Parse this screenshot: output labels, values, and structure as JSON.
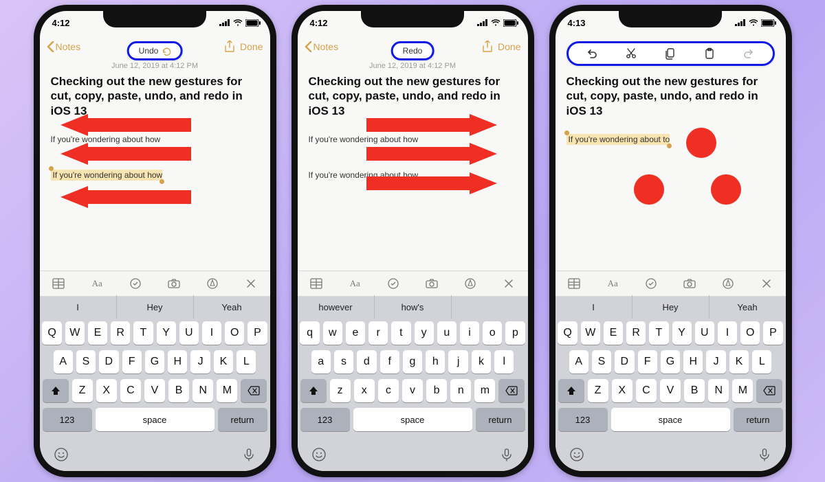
{
  "phones": [
    {
      "time": "4:12",
      "toast": "Undo",
      "back": "Notes",
      "done": "Done",
      "date": "June 12, 2019 at 4:12 PM",
      "title": "Checking out the new gestures for cut, copy, paste, undo, and redo in  iOS 13",
      "line1": "If you're wondering about how",
      "selected": "If you're wondering about how",
      "predict": [
        "I",
        "Hey",
        "Yeah"
      ],
      "keyboard_case": "upper"
    },
    {
      "time": "4:12",
      "toast": "Redo",
      "back": "Notes",
      "done": "Done",
      "date": "June 12, 2019 at 4:12 PM",
      "title": "Checking out the new gestures for cut, copy, paste, undo, and redo in  iOS 13",
      "line1": "If you're wondering about how",
      "line2": "If you're wondering about how",
      "predict": [
        "however",
        "how's",
        ""
      ],
      "keyboard_case": "lower"
    },
    {
      "time": "4:13",
      "back": "",
      "done": "",
      "date": "",
      "title": "Checking out the new gestures for cut, copy, paste, undo, and redo in  iOS 13",
      "selected": "If you're wondering about to",
      "predict": [
        "I",
        "Hey",
        "Yeah"
      ],
      "keyboard_case": "upper",
      "edit_toolbar": [
        "undo",
        "cut",
        "copy",
        "paste",
        "redo"
      ]
    }
  ],
  "keys_upper": {
    "r1": [
      "Q",
      "W",
      "E",
      "R",
      "T",
      "Y",
      "U",
      "I",
      "O",
      "P"
    ],
    "r2": [
      "A",
      "S",
      "D",
      "F",
      "G",
      "H",
      "J",
      "K",
      "L"
    ],
    "r3": [
      "Z",
      "X",
      "C",
      "V",
      "B",
      "N",
      "M"
    ]
  },
  "keys_lower": {
    "r1": [
      "q",
      "w",
      "e",
      "r",
      "t",
      "y",
      "u",
      "i",
      "o",
      "p"
    ],
    "r2": [
      "a",
      "s",
      "d",
      "f",
      "g",
      "h",
      "j",
      "k",
      "l"
    ],
    "r3": [
      "z",
      "x",
      "c",
      "v",
      "b",
      "n",
      "m"
    ]
  },
  "kb_labels": {
    "numeric": "123",
    "space": "space",
    "return": "return"
  },
  "colors": {
    "accent": "#d6a24a",
    "highlight": "#1019e6",
    "gesture": "#ef2e24"
  }
}
